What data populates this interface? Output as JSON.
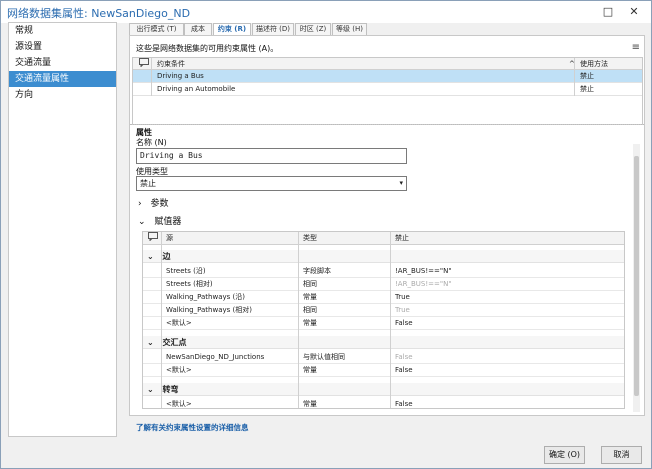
{
  "window": {
    "title": "网络数据集属性: NewSanDiego_ND",
    "minimize": "□",
    "close": "✕"
  },
  "sidebar": {
    "items": [
      {
        "label": "常规"
      },
      {
        "label": "源设置"
      },
      {
        "label": "交通流量"
      },
      {
        "label": "交通流量属性"
      },
      {
        "label": "方向"
      }
    ],
    "active_index": 3
  },
  "tabs": [
    {
      "label": "出行模式 (T)"
    },
    {
      "label": "成本 (C)"
    },
    {
      "label": "约束 (R)"
    },
    {
      "label": "描述符 (D)"
    },
    {
      "label": "时区 (Z)"
    },
    {
      "label": "等级 (H)"
    }
  ],
  "active_tab": 2,
  "panel": {
    "description": "这些是网络数据集的可用约束属性 (A)。",
    "menu_icon": "≡"
  },
  "constraints_table": {
    "header_icon": "comment-icon",
    "col_name": "约束条件",
    "col_usage": "使用方法",
    "sort_glyph": "^",
    "rows": [
      {
        "name": "Driving a Bus",
        "usage": "禁止"
      },
      {
        "name": "Driving an Automobile",
        "usage": "禁止"
      }
    ]
  },
  "properties": {
    "section_title": "属性",
    "name_label": "名称 (N)",
    "name_value": "Driving a Bus",
    "usage_label": "使用类型",
    "usage_value": "禁止",
    "params_label": "参数",
    "evaluators_label": "赋值器"
  },
  "evaluators_table": {
    "col_source": "源",
    "col_type": "类型",
    "col_value": "禁止",
    "groups": [
      {
        "label": "边",
        "rows": [
          {
            "source": "Streets (沿)",
            "type": "字段脚本",
            "value": "!AR_BUS!==\"N\"",
            "muted": false
          },
          {
            "source": "Streets (相对)",
            "type": "相同",
            "value": "!AR_BUS!==\"N\"",
            "muted": true
          },
          {
            "source": "Walking_Pathways (沿)",
            "type": "常量",
            "value": "True",
            "muted": false
          },
          {
            "source": "Walking_Pathways (相对)",
            "type": "相同",
            "value": "True",
            "muted": true
          },
          {
            "source": "<默认>",
            "type": "常量",
            "value": "False",
            "muted": false
          }
        ]
      },
      {
        "label": "交汇点",
        "rows": [
          {
            "source": "NewSanDiego_ND_Junctions",
            "type": "与默认值相同",
            "value": "False",
            "muted": true
          },
          {
            "source": "<默认>",
            "type": "常量",
            "value": "False",
            "muted": false
          }
        ]
      },
      {
        "label": "转弯",
        "rows": [
          {
            "source": "<默认>",
            "type": "常量",
            "value": "False",
            "muted": false
          }
        ]
      }
    ]
  },
  "footer": {
    "learn_more": "了解有关约束属性设置的详细信息",
    "ok": "确定 (O)",
    "cancel": "取消"
  },
  "colors": {
    "accent": "#3c8dd0",
    "selected_row": "#bfe0f6",
    "title_text": "#2b6cb0"
  }
}
